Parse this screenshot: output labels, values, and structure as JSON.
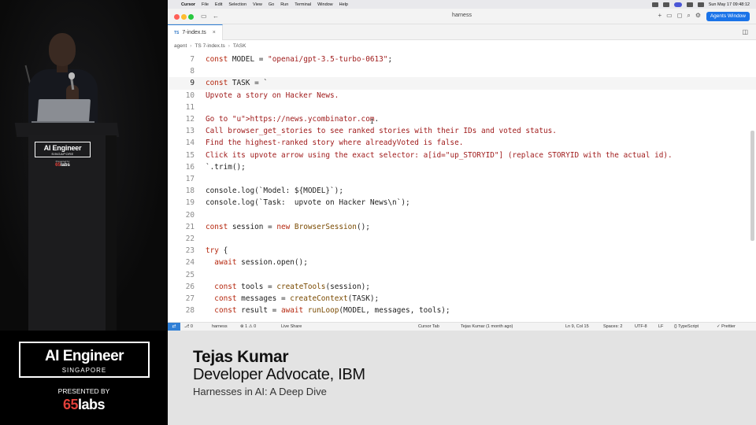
{
  "speaker_video": {
    "podium_brand_title": "AI Engineer",
    "podium_brand_sub": "SINGAPORE",
    "podium_brand_by": "Presented by",
    "podium_brand_num": "65",
    "podium_brand_word": "labs"
  },
  "mac_menubar": {
    "apple": "",
    "items": [
      "Cursor",
      "File",
      "Edit",
      "Selection",
      "View",
      "Go",
      "Run",
      "Terminal",
      "Window",
      "Help"
    ],
    "datetime": "Sun May 17  09:48:12"
  },
  "titlebar": {
    "window_title": "harness",
    "agents_button": "Agents Window"
  },
  "tab": {
    "badge": "TS",
    "filename": "7-index.ts",
    "close": "×"
  },
  "breadcrumb": {
    "items": [
      "agent",
      "TS 7-index.ts",
      "TASK"
    ],
    "separator": "›"
  },
  "code_lines": [
    {
      "n": "7",
      "text": "const MODEL = \"openai/gpt-3.5-turbo-0613\";"
    },
    {
      "n": "8",
      "text": ""
    },
    {
      "n": "9",
      "text": "const TASK = `"
    },
    {
      "n": "10",
      "text": "Upvote a story on Hacker News."
    },
    {
      "n": "11",
      "text": ""
    },
    {
      "n": "12",
      "text": "Go to https://news.ycombinator.com."
    },
    {
      "n": "13",
      "text": "Call browser_get_stories to see ranked stories with their IDs and voted status."
    },
    {
      "n": "14",
      "text": "Find the highest-ranked story where alreadyVoted is false."
    },
    {
      "n": "15",
      "text": "Click its upvote arrow using the exact selector: a[id=\"up_STORYID\"] (replace STORYID with the actual id)."
    },
    {
      "n": "16",
      "text": "`.trim();"
    },
    {
      "n": "17",
      "text": ""
    },
    {
      "n": "18",
      "text": "console.log(`Model: ${MODEL}`);"
    },
    {
      "n": "19",
      "text": "console.log(`Task:  upvote on Hacker News\\n`);"
    },
    {
      "n": "20",
      "text": ""
    },
    {
      "n": "21",
      "text": "const session = new BrowserSession();"
    },
    {
      "n": "22",
      "text": ""
    },
    {
      "n": "23",
      "text": "try {"
    },
    {
      "n": "24",
      "text": "  await session.open();"
    },
    {
      "n": "25",
      "text": ""
    },
    {
      "n": "26",
      "text": "  const tools = createTools(session);"
    },
    {
      "n": "27",
      "text": "  const messages = createContext(TASK);"
    },
    {
      "n": "28",
      "text": "  const result = await runLoop(MODEL, messages, tools);"
    }
  ],
  "active_line": "9",
  "statusbar": {
    "remote": "⇄",
    "branch": "⎇ 0",
    "project": "harness",
    "problems": "⊗ 1  ⚠ 0",
    "live_share": "Live Share",
    "cursor_tab": "Cursor Tab",
    "blame": "Tejas Kumar (1 month ago)",
    "position": "Ln 9, Col 15",
    "spaces": "Spaces: 2",
    "encoding": "UTF-8",
    "eol": "LF",
    "language": "{} TypeScript",
    "prettier": "✓ Prettier"
  },
  "lower_third": {
    "event_title": "AI Engineer",
    "event_sub": "SINGAPORE",
    "presented_by": "PRESENTED BY",
    "sponsor_num": "65",
    "sponsor_word": "labs",
    "speaker_name": "Tejas Kumar",
    "speaker_role": "Developer Advocate, IBM",
    "talk_title": "Harnesses in AI: A Deep Dive"
  },
  "colors": {
    "accent": "#1a73e8",
    "keyword": "#b5270e",
    "string": "#a01c1c",
    "sponsor_red": "#e0403a"
  }
}
